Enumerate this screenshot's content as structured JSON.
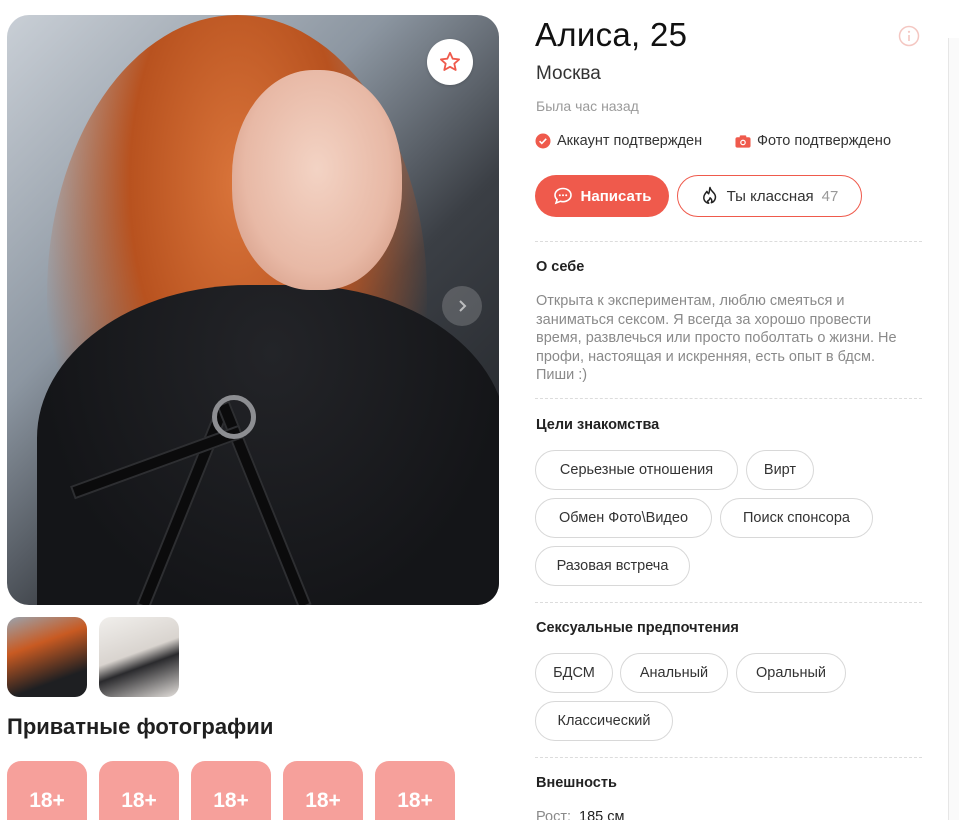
{
  "profile": {
    "name_age": "Алиса, 25",
    "city": "Москва",
    "last_seen": "Была час назад",
    "verified_account": "Аккаунт подтвержден",
    "verified_photo": "Фото подтверждено"
  },
  "actions": {
    "write_label": "Написать",
    "like_label": "Ты классная",
    "like_count": "47"
  },
  "about": {
    "title": "О себе",
    "text": "Открыта к экспериментам, люблю смеяться и заниматься сексом. Я всегда за хорошо провести время, развлечься или просто поболтать о жизни. Не профи, настоящая и искренняя, есть опыт в бдсм. Пиши :)"
  },
  "goals": {
    "title": "Цели знакомства",
    "tags": [
      "Серьезные отношения",
      "Вирт",
      "Обмен Фото\\Видео",
      "Поиск спонсора",
      "Разовая встреча"
    ]
  },
  "preferences": {
    "title": "Сексуальные предпочтения",
    "tags": [
      "БДСМ",
      "Анальный",
      "Оральный",
      "Классический"
    ]
  },
  "appearance": {
    "title": "Внешность",
    "height_label": "Рост:",
    "height_value": "185 см"
  },
  "private_photos": {
    "title": "Приватные фотографии",
    "tiles": [
      "18+",
      "18+",
      "18+",
      "18+",
      "18+"
    ]
  },
  "colors": {
    "accent": "#ef5a4c",
    "private_tile": "#f6a09b"
  }
}
